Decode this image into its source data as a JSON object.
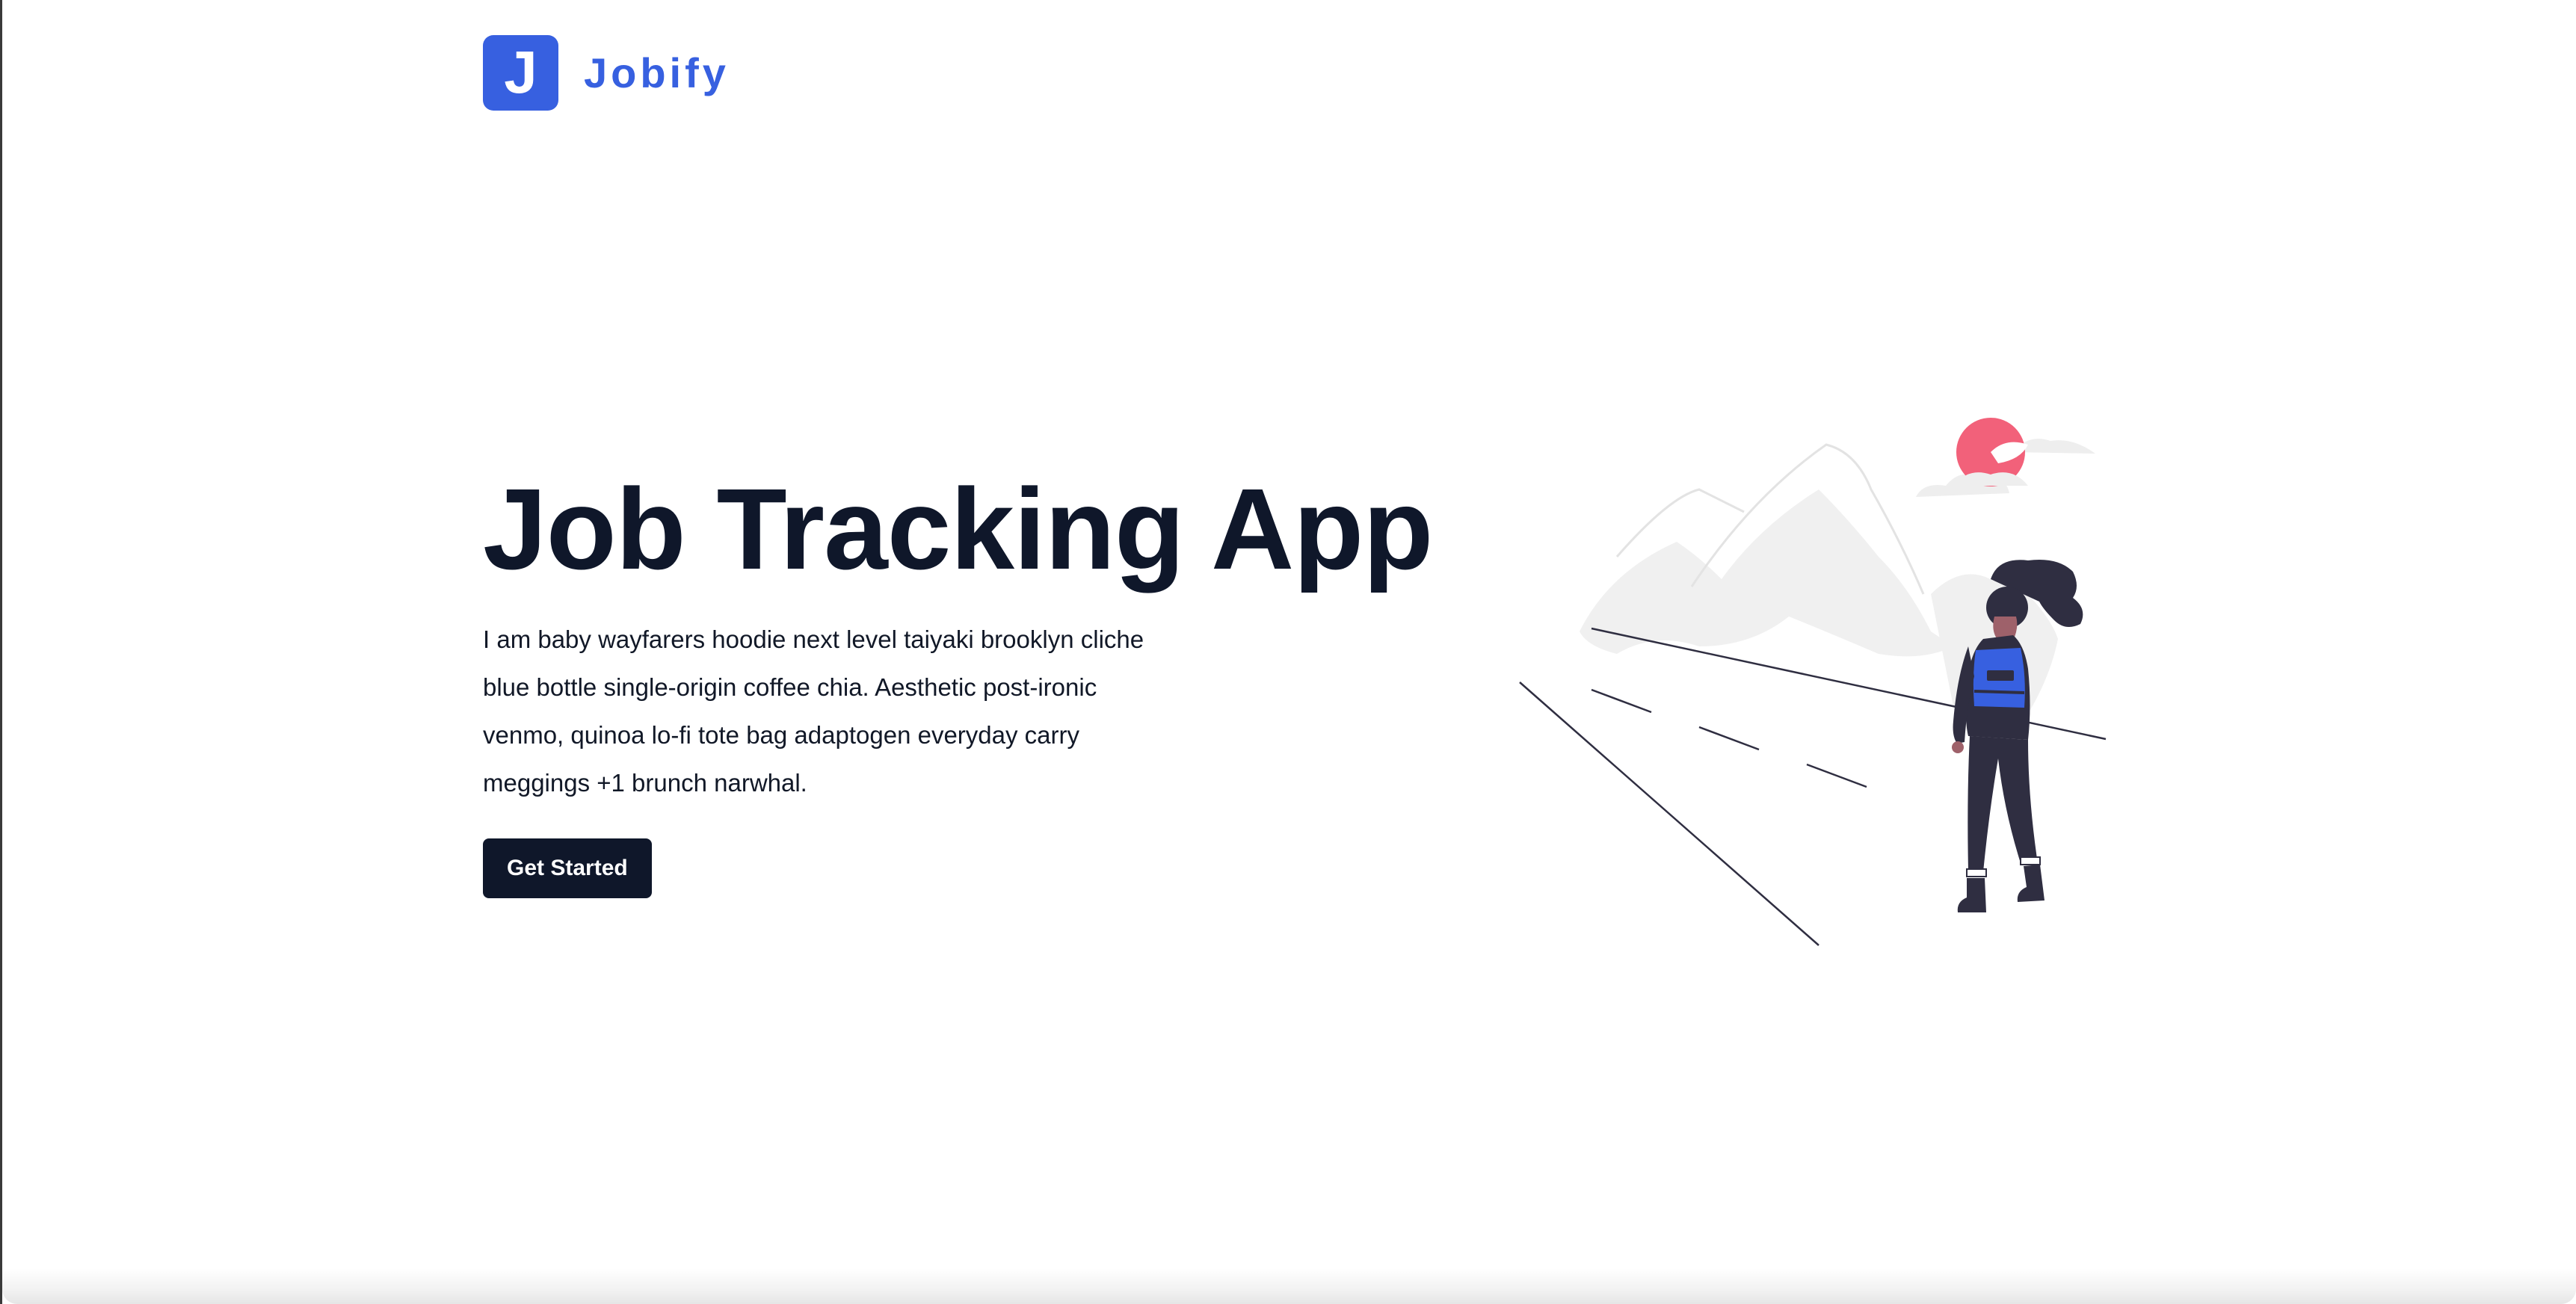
{
  "brand": {
    "logo_letter": "J",
    "name": "Jobify",
    "color": "#3760e0"
  },
  "hero": {
    "title": "Job Tracking App",
    "description": "I am baby wayfarers hoodie next level taiyaki brooklyn cliche blue bottle single-origin coffee chia. Aesthetic post-ironic venmo, quinoa lo-fi tote bag adaptogen everyday carry meggings +1 brunch narwhal.",
    "cta_label": "Get Started"
  },
  "illustration": {
    "icon": "person-hiking-illustration",
    "sun_color": "#f2617a",
    "accent_color": "#3760e0",
    "dark_color": "#2f2e41"
  }
}
